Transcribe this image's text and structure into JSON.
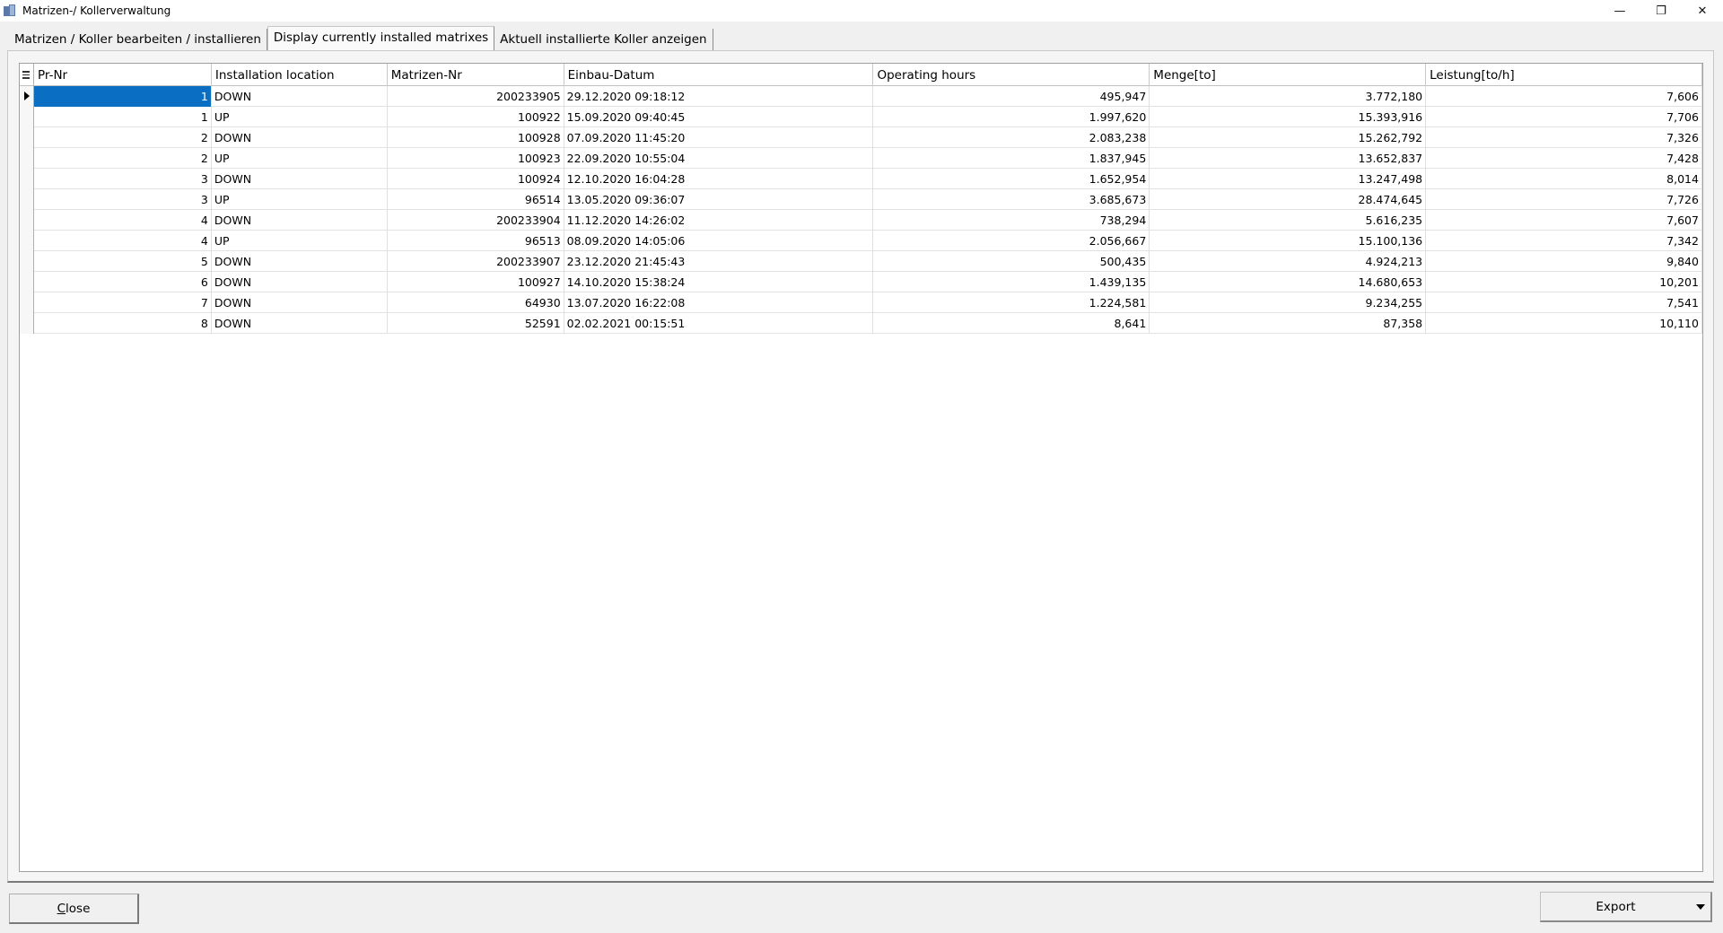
{
  "window": {
    "title": "Matrizen-/ Kollerverwaltung",
    "controls": {
      "minimize": "—",
      "restore": "❐",
      "close": "✕"
    }
  },
  "tabs": [
    {
      "label": "Matrizen / Koller bearbeiten / installieren"
    },
    {
      "label": "Display currently installed matrixes"
    },
    {
      "label": "Aktuell installierte Koller anzeigen"
    }
  ],
  "grid": {
    "columns": [
      "Pr-Nr",
      "Installation location",
      "Matrizen-Nr",
      "Einbau-Datum",
      "Operating hours",
      "Menge[to]",
      "Leistung[to/h]"
    ],
    "rows": [
      [
        "1",
        "DOWN",
        "200233905",
        "29.12.2020 09:18:12",
        "495,947",
        "3.772,180",
        "7,606"
      ],
      [
        "1",
        "UP",
        "100922",
        "15.09.2020 09:40:45",
        "1.997,620",
        "15.393,916",
        "7,706"
      ],
      [
        "2",
        "DOWN",
        "100928",
        "07.09.2020 11:45:20",
        "2.083,238",
        "15.262,792",
        "7,326"
      ],
      [
        "2",
        "UP",
        "100923",
        "22.09.2020 10:55:04",
        "1.837,945",
        "13.652,837",
        "7,428"
      ],
      [
        "3",
        "DOWN",
        "100924",
        "12.10.2020 16:04:28",
        "1.652,954",
        "13.247,498",
        "8,014"
      ],
      [
        "3",
        "UP",
        "96514",
        "13.05.2020 09:36:07",
        "3.685,673",
        "28.474,645",
        "7,726"
      ],
      [
        "4",
        "DOWN",
        "200233904",
        "11.12.2020 14:26:02",
        "738,294",
        "5.616,235",
        "7,607"
      ],
      [
        "4",
        "UP",
        "96513",
        "08.09.2020 14:05:06",
        "2.056,667",
        "15.100,136",
        "7,342"
      ],
      [
        "5",
        "DOWN",
        "200233907",
        "23.12.2020 21:45:43",
        "500,435",
        "4.924,213",
        "9,840"
      ],
      [
        "6",
        "DOWN",
        "100927",
        "14.10.2020 15:38:24",
        "1.439,135",
        "14.680,653",
        "10,201"
      ],
      [
        "7",
        "DOWN",
        "64930",
        "13.07.2020 16:22:08",
        "1.224,581",
        "9.234,255",
        "7,541"
      ],
      [
        "8",
        "DOWN",
        "52591",
        "02.02.2021 00:15:51",
        "8,641",
        "87,358",
        "10,110"
      ]
    ]
  },
  "buttons": {
    "close_first": "C",
    "close_rest": "lose",
    "export": "Export"
  },
  "colors": {
    "selection": "#0a6fc2"
  }
}
